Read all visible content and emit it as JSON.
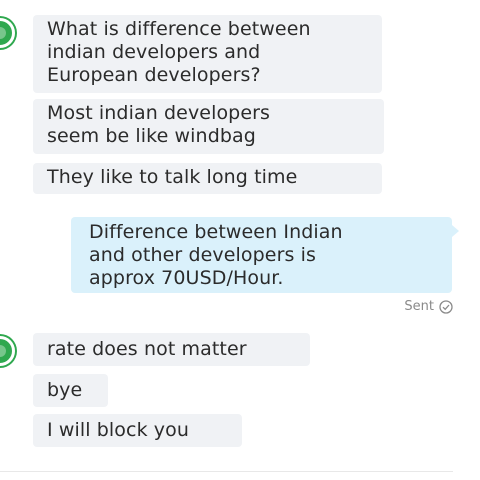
{
  "conversation": {
    "group1": {
      "messages": [
        {
          "text": "What is difference between\nindian developers and\nEuropean developers?"
        },
        {
          "text": "Most indian developers\nseem be like windbag"
        },
        {
          "text": "They like to talk long time"
        }
      ]
    },
    "outgoing": {
      "text": "Difference between Indian\nand other developers is\napprox 70USD/Hour.",
      "status": "Sent"
    },
    "group2": {
      "messages": [
        {
          "text": "rate does not matter"
        },
        {
          "text": "bye"
        },
        {
          "text": "I will block you"
        }
      ]
    }
  },
  "colors": {
    "incoming_bubble": "#f0f2f5",
    "outgoing_bubble": "#daf1fb",
    "avatar": "#2fa84f"
  }
}
